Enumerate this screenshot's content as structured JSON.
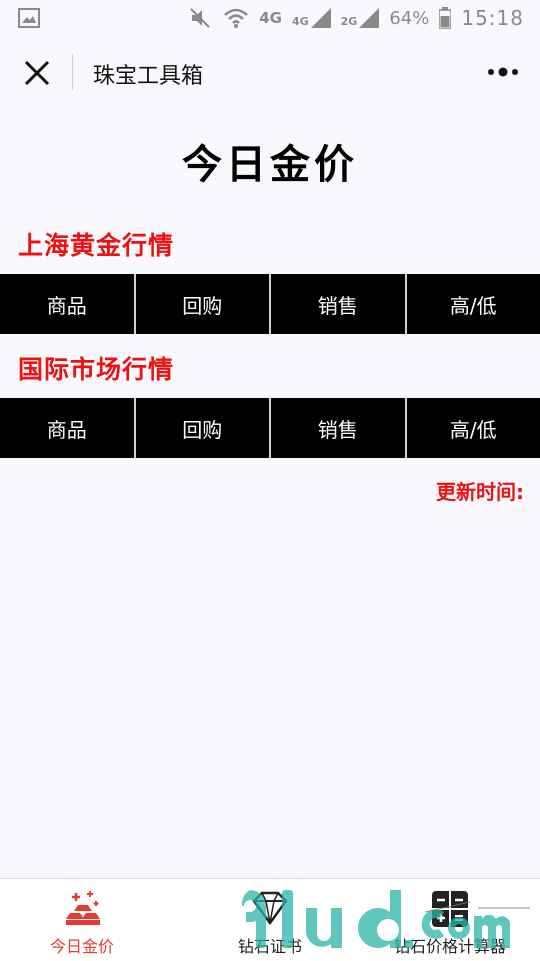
{
  "status_bar": {
    "network_label": "4G",
    "sim1_label": "4G",
    "sim2_label": "2G",
    "battery_percent": "64%",
    "time": "15:18"
  },
  "nav": {
    "title": "珠宝工具箱"
  },
  "page": {
    "title": "今日金价"
  },
  "sections": [
    {
      "title": "上海黄金行情",
      "columns": [
        "商品",
        "回购",
        "销售",
        "高/低"
      ]
    },
    {
      "title": "国际市场行情",
      "columns": [
        "商品",
        "回购",
        "销售",
        "高/低"
      ]
    }
  ],
  "update_label": "更新时间:",
  "tab_bar": {
    "tabs": [
      {
        "label": "今日金价",
        "icon": "gold-bars-icon",
        "active": true
      },
      {
        "label": "钻石证书",
        "icon": "diamond-icon",
        "active": false
      },
      {
        "label": "钻石价格计算器",
        "icon": "calculator-icon",
        "active": false
      }
    ]
  },
  "colors": {
    "accent_red": "#ee1111",
    "tab_active": "#e73b2f",
    "table_header_bg": "#000000",
    "background": "#f9f8fd"
  }
}
